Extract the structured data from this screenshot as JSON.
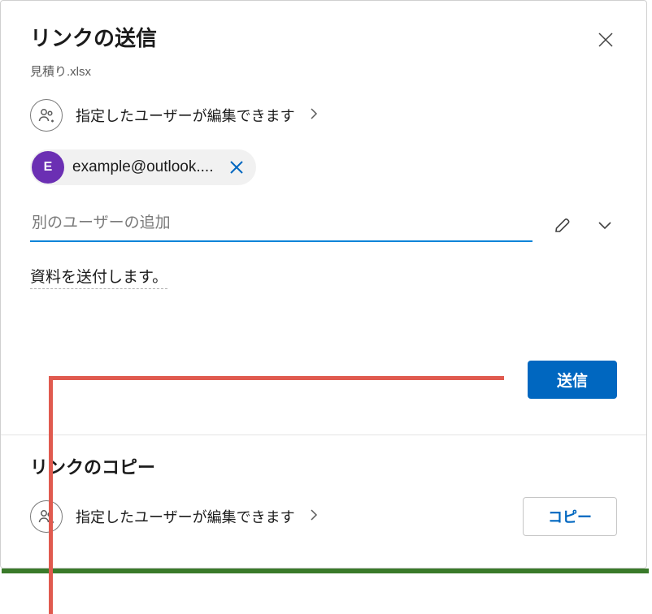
{
  "dialog": {
    "title": "リンクの送信",
    "filename": "見積り.xlsx"
  },
  "permission": {
    "text": "指定したユーザーが編集できます"
  },
  "recipient": {
    "initial": "E",
    "email": "example@outlook...."
  },
  "addUser": {
    "placeholder": "別のユーザーの追加"
  },
  "message": {
    "text": "資料を送付します。"
  },
  "buttons": {
    "send": "送信",
    "copy": "コピー"
  },
  "copySection": {
    "title": "リンクのコピー",
    "permission": "指定したユーザーが編集できます"
  }
}
